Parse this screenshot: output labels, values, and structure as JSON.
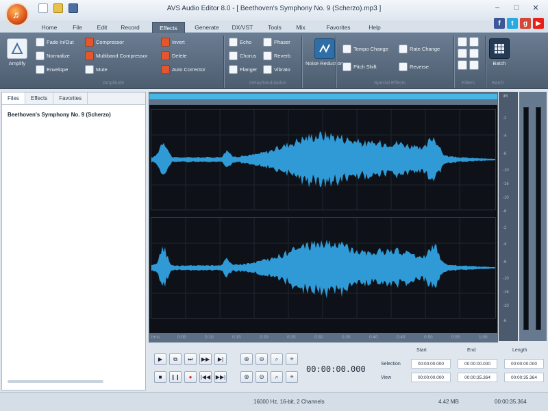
{
  "window": {
    "title": "AVS Audio Editor 8.0 - [ Beethoven's Symphony No. 9 (Scherzo).mp3 ]",
    "controls": [
      "–",
      "□",
      "✕"
    ]
  },
  "tabs": [
    "Home",
    "File",
    "Edit",
    "Record",
    "Effects",
    "Generate",
    "DX/VST",
    "Tools",
    "Mix",
    "Favorites",
    "Help"
  ],
  "active_tab": "Effects",
  "social": [
    {
      "label": "f",
      "color": "#3b5998"
    },
    {
      "label": "t",
      "color": "#2aa9e0"
    },
    {
      "label": "g",
      "color": "#d34836"
    },
    {
      "label": "▶",
      "color": "#e62117"
    }
  ],
  "ribbon": {
    "amplify": "Amplify",
    "col1": [
      "Fade In/Out",
      "Normalize",
      "Envelope"
    ],
    "col2": [
      "Compressor",
      "Multiband Compressor",
      "Mute"
    ],
    "col3": [
      "Invert",
      "Delete",
      "Auto Corrector"
    ],
    "col4": [
      "Echo",
      "Chorus",
      "Flanger"
    ],
    "col5": [
      "Phaser",
      "Reverb",
      "Vibrato"
    ],
    "noise_reduction": "Noise Reduction",
    "col6": [
      "Tempo Change",
      "Pitch Shift"
    ],
    "col7": [
      "Rate Change",
      "Reverse"
    ],
    "batch": "Batch",
    "groups": [
      "Amplitude",
      "Delay/Modulation",
      "Special Effects",
      "Filters",
      "Batch"
    ]
  },
  "left_panel": {
    "tabs": [
      "Files",
      "Effects",
      "Favorites"
    ],
    "active_tab": "Files",
    "file": "Beethoven's Symphony No. 9 (Scherzo)"
  },
  "ruler_labels": [
    "hms",
    "0:05",
    "0:10",
    "0:15",
    "0:20",
    "0:25",
    "0:30",
    "0:35",
    "0:40",
    "0:45",
    "0:50",
    "0:55",
    "1:00"
  ],
  "db_labels": [
    "dB",
    "-2",
    "-4",
    "-6",
    "-10",
    "-16",
    "-10",
    "-6",
    "-4",
    "-2",
    "dB",
    "-2",
    "-4",
    "-6",
    "-10",
    "-16",
    "-10",
    "-6",
    "-4",
    "-2"
  ],
  "transport": {
    "row1": [
      "▶",
      "⧉",
      "⏭",
      "▶▶",
      "▶|"
    ],
    "row2": [
      "■",
      "❙❙",
      "●",
      "|◀◀",
      "▶▶|"
    ],
    "zoom_row1": [
      "⊕",
      "⊖",
      "⌕",
      "⌖"
    ],
    "zoom_row2": [
      "⊕",
      "⊖",
      "⌕",
      "⌖"
    ]
  },
  "timecode": "00:00:00.000",
  "selection": {
    "headers": [
      "Start",
      "End",
      "Length"
    ],
    "rows": [
      {
        "label": "Selection",
        "values": [
          "00:00:00.000",
          "00:00:00.000",
          "00:00:00.000"
        ]
      },
      {
        "label": "View",
        "values": [
          "00:00:00.000",
          "00:00:35.364",
          "00:00:35.364"
        ]
      }
    ]
  },
  "status": {
    "format": "16000 Hz, 16-bit, 2 Channels",
    "size": "4.42 MB",
    "duration": "00:00:35.364"
  }
}
